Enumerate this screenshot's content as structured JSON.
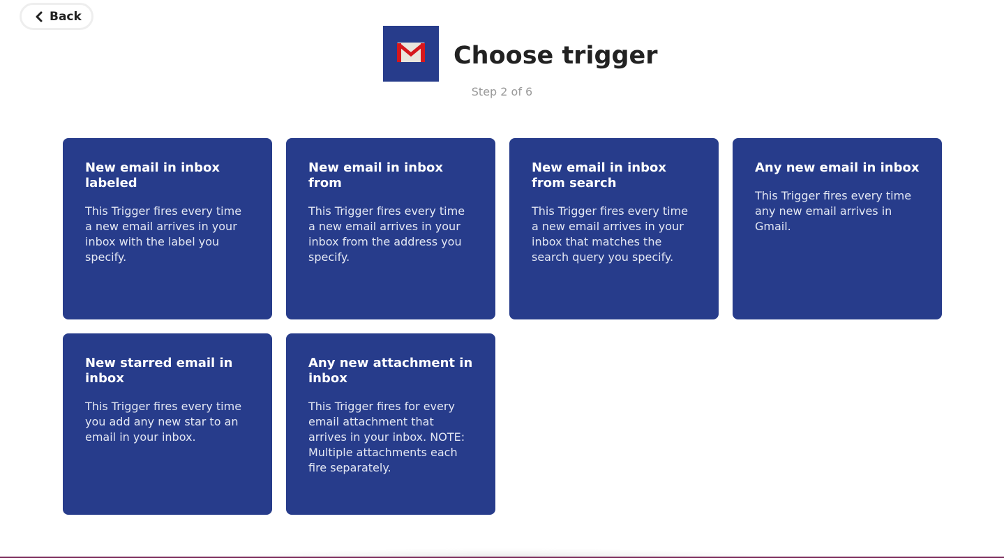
{
  "nav": {
    "back_label": "Back"
  },
  "header": {
    "service_icon": "gmail-icon",
    "title": "Choose trigger",
    "step": "Step 2 of 6"
  },
  "colors": {
    "card_background": "#273c8b",
    "title_text": "#222222",
    "step_text": "#999999"
  },
  "triggers": [
    {
      "title": "New email in inbox labeled",
      "description": "This Trigger fires every time a new email arrives in your inbox with the label you specify."
    },
    {
      "title": "New email in inbox from",
      "description": "This Trigger fires every time a new email arrives in your inbox from the address you specify."
    },
    {
      "title": "New email in inbox from search",
      "description": "This Trigger fires every time a new email arrives in your inbox that matches the search query you specify."
    },
    {
      "title": "Any new email in inbox",
      "description": "This Trigger fires every time any new email arrives in Gmail."
    },
    {
      "title": "New starred email in inbox",
      "description": "This Trigger fires every time you add any new star to an email in your inbox."
    },
    {
      "title": "Any new attachment in inbox",
      "description": "This Trigger fires for every email attachment that arrives in your inbox. NOTE: Multiple attachments each fire separately."
    }
  ]
}
